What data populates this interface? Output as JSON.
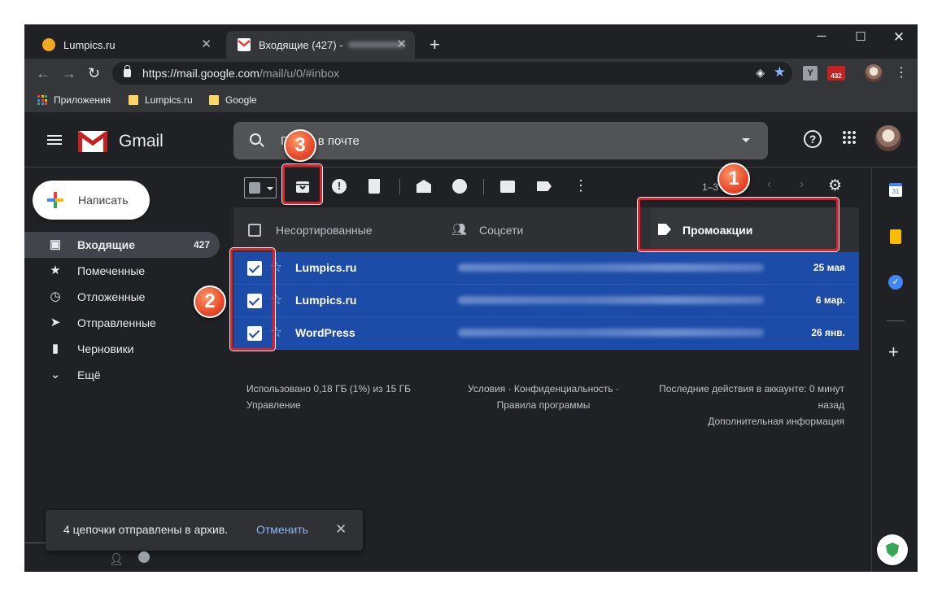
{
  "browser": {
    "tabs": [
      {
        "title": "Lumpics.ru"
      },
      {
        "title": "Входящие (427) -"
      }
    ],
    "new_tab": "+",
    "address": {
      "host": "https://mail.google.com",
      "path": "/mail/u/0/#inbox"
    },
    "ext_badge": "432",
    "ext_y": "Y",
    "bookmarks": [
      "Приложения",
      "Lumpics.ru",
      "Google"
    ]
  },
  "gmail": {
    "logo_text": "Gmail",
    "search_placeholder": "Поиск в почте",
    "compose_label": "Написать",
    "nav": [
      {
        "label": "Входящие",
        "count": "427",
        "icon": "inbox-icon"
      },
      {
        "label": "Помеченные",
        "icon": "star-icon"
      },
      {
        "label": "Отложенные",
        "icon": "clock-icon"
      },
      {
        "label": "Отправленные",
        "icon": "send-icon"
      },
      {
        "label": "Черновики",
        "icon": "draft-icon"
      },
      {
        "label": "Ещё",
        "icon": "chevron-down-icon"
      }
    ],
    "pagination": "1–3",
    "categories": [
      "Несортированные",
      "Соцсети",
      "Промоакции"
    ],
    "emails": [
      {
        "sender": "Lumpics.ru",
        "date": "25 мая",
        "checked": true
      },
      {
        "sender": "Lumpics.ru",
        "date": "6 мар.",
        "checked": true
      },
      {
        "sender": "WordPress",
        "date": "26 янв.",
        "checked": true
      }
    ],
    "footer": {
      "storage": "Использовано 0,18 ГБ (1%) из 15 ГБ",
      "manage": "Управление",
      "terms": "Условия · Конфиденциальность ·",
      "policies": "Правила программы",
      "activity": "Последние действия в аккаунте: 0 минут",
      "activity2": "назад",
      "details": "Дополнительная информация"
    },
    "snackbar": {
      "message": "4 цепочки отправлены в архив.",
      "action": "Отменить"
    }
  },
  "annotations": [
    "1",
    "2",
    "3"
  ],
  "colors": {
    "selected_row": "#1c4ca8",
    "highlight": "#e3202a",
    "badge": "#e8492a"
  }
}
